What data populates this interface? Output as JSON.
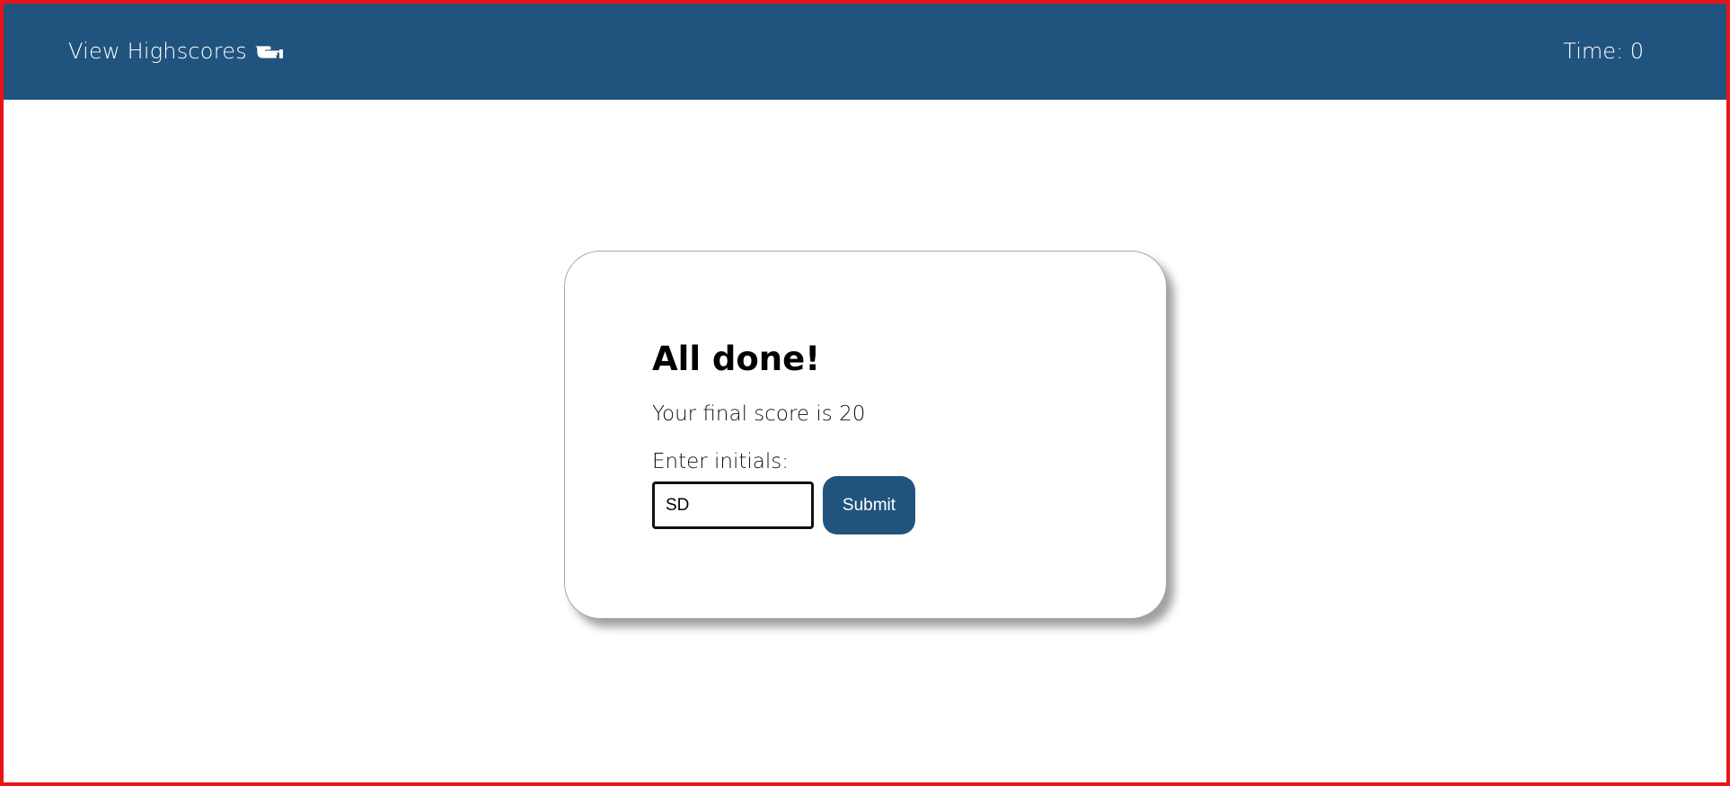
{
  "topbar": {
    "highscores_label": "View Highscores",
    "highscores_icon": "pointing-hand-icon",
    "timer_label": "Time: 0"
  },
  "card": {
    "title": "All done!",
    "score_text": "Your final score is 20",
    "initials_label": "Enter initials:",
    "initials_value": "SD",
    "initials_placeholder": "",
    "submit_label": "Submit"
  },
  "colors": {
    "header_bg": "#20547e",
    "accent": "#20547e",
    "frame_border": "#e8141a",
    "text": "#000000"
  }
}
